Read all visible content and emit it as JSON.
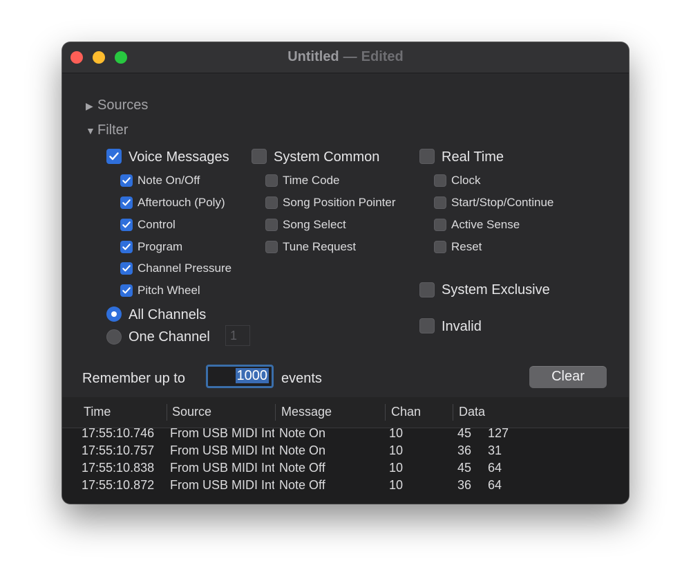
{
  "window": {
    "title": "Untitled",
    "title_sep": "—",
    "edited": "Edited"
  },
  "sources": {
    "label": "Sources",
    "expanded": false
  },
  "filter": {
    "label": "Filter",
    "expanded": true,
    "voice_messages": {
      "label": "Voice Messages",
      "checked": true
    },
    "voice_items": [
      {
        "label": "Note On/Off",
        "checked": true
      },
      {
        "label": "Aftertouch (Poly)",
        "checked": true
      },
      {
        "label": "Control",
        "checked": true
      },
      {
        "label": "Program",
        "checked": true
      },
      {
        "label": "Channel Pressure",
        "checked": true
      },
      {
        "label": "Pitch Wheel",
        "checked": true
      }
    ],
    "system_common": {
      "label": "System Common",
      "checked": false
    },
    "system_common_items": [
      {
        "label": "Time Code",
        "checked": false
      },
      {
        "label": "Song Position Pointer",
        "checked": false
      },
      {
        "label": "Song Select",
        "checked": false
      },
      {
        "label": "Tune Request",
        "checked": false
      }
    ],
    "real_time": {
      "label": "Real Time",
      "checked": false
    },
    "real_time_items": [
      {
        "label": "Clock",
        "checked": false
      },
      {
        "label": "Start/Stop/Continue",
        "checked": false
      },
      {
        "label": "Active Sense",
        "checked": false
      },
      {
        "label": "Reset",
        "checked": false
      }
    ],
    "system_exclusive": {
      "label": "System Exclusive",
      "checked": false
    },
    "invalid": {
      "label": "Invalid",
      "checked": false
    },
    "channels": {
      "all_label": "All Channels",
      "one_label": "One Channel",
      "selected": "all",
      "channel_value": "1"
    }
  },
  "remember": {
    "prefix": "Remember up to",
    "value": "1000",
    "suffix": "events"
  },
  "clear_label": "Clear",
  "table": {
    "columns": [
      "Time",
      "Source",
      "Message",
      "Chan",
      "Data"
    ],
    "rows": [
      {
        "time": "17:55:10.746",
        "source": "From USB MIDI Interface",
        "message": "Note On",
        "chan": "10",
        "data1": "45",
        "data2": "127"
      },
      {
        "time": "17:55:10.757",
        "source": "From USB MIDI Interface",
        "message": "Note On",
        "chan": "10",
        "data1": "36",
        "data2": "31"
      },
      {
        "time": "17:55:10.838",
        "source": "From USB MIDI Interface",
        "message": "Note Off",
        "chan": "10",
        "data1": "45",
        "data2": "64"
      },
      {
        "time": "17:55:10.872",
        "source": "From USB MIDI Interface",
        "message": "Note Off",
        "chan": "10",
        "data1": "36",
        "data2": "64"
      }
    ]
  }
}
